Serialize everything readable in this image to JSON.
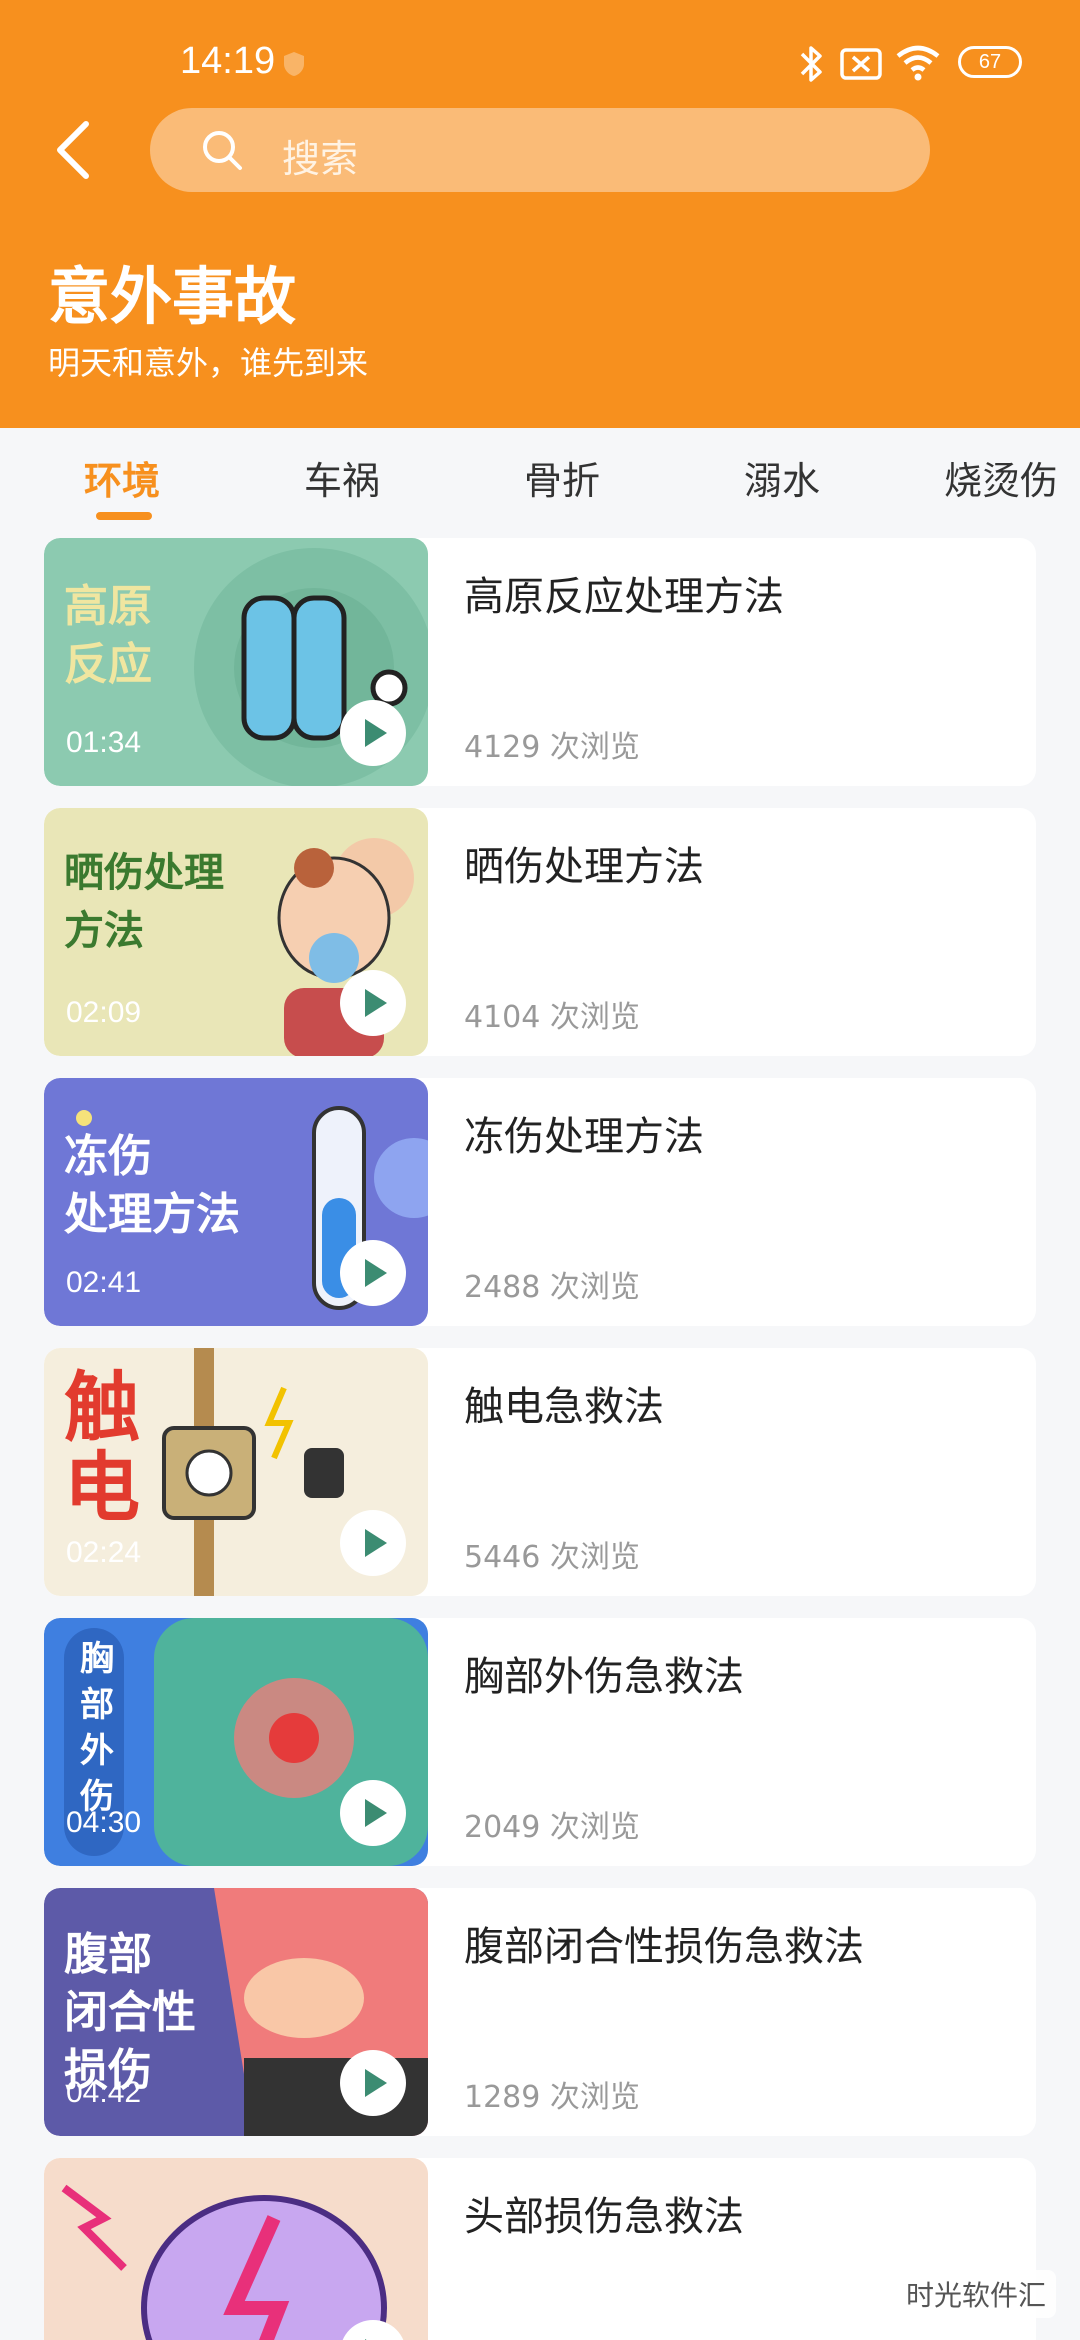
{
  "status": {
    "time": "14:19",
    "battery": "67"
  },
  "search": {
    "placeholder": "搜索"
  },
  "page": {
    "title": "意外事故",
    "subtitle": "明天和意外，谁先到来"
  },
  "tabs": [
    {
      "label": "环境"
    },
    {
      "label": "车祸"
    },
    {
      "label": "骨折"
    },
    {
      "label": "溺水"
    },
    {
      "label": "烧烫伤"
    }
  ],
  "videos": [
    {
      "title": "高原反应处理方法",
      "views": "4129 次浏览",
      "duration": "01:34",
      "thumb_text": "高原\n反应",
      "thumb_color": "#8ccab0"
    },
    {
      "title": "晒伤处理方法",
      "views": "4104 次浏览",
      "duration": "02:09",
      "thumb_text": "晒伤处理\n方法",
      "thumb_color": "#e9e6b7"
    },
    {
      "title": "冻伤处理方法",
      "views": "2488 次浏览",
      "duration": "02:41",
      "thumb_text": "冻伤\n处理方法",
      "thumb_color": "#6f77d6"
    },
    {
      "title": "触电急救法",
      "views": "5446 次浏览",
      "duration": "02:24",
      "thumb_text": "触\n电",
      "thumb_color": "#f5eedd"
    },
    {
      "title": "胸部外伤急救法",
      "views": "2049 次浏览",
      "duration": "04:30",
      "thumb_text": "胸\n部\n外\n伤",
      "thumb_color": "#3f7fe0"
    },
    {
      "title": "腹部闭合性损伤急救法",
      "views": "1289 次浏览",
      "duration": "04:42",
      "thumb_text": "腹部\n闭合性\n损伤",
      "thumb_color": "#5d5aa8"
    },
    {
      "title": "头部损伤急救法",
      "views": "",
      "duration": "",
      "thumb_text": "",
      "thumb_color": "#f6dccb"
    }
  ],
  "watermark": "时光软件汇",
  "colors": {
    "accent": "#f7901e",
    "search_bg": "#fabb77"
  }
}
